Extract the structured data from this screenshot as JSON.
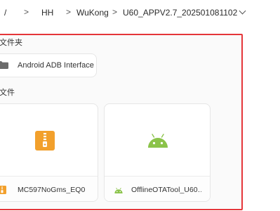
{
  "breadcrumb": {
    "items": [
      "/",
      "HH",
      "WuKong",
      "U60_APPV2.7_202501081102"
    ],
    "separator": ">"
  },
  "sections": {
    "folders_label": "文件夹",
    "files_label": "文件"
  },
  "folders": [
    {
      "name": "Android ADB Interface",
      "icon": "folder-icon"
    }
  ],
  "files": [
    {
      "name": "MC597NoGms_EQ0…",
      "icon": "zip-archive-icon"
    },
    {
      "name": "OfflineOTATool_U60…",
      "icon": "android-icon"
    }
  ],
  "colors": {
    "highlight_border": "#e5363a",
    "zip_orange": "#f2a02c",
    "android_green": "#8bc34a",
    "folder_gray": "#6b6b6b"
  }
}
